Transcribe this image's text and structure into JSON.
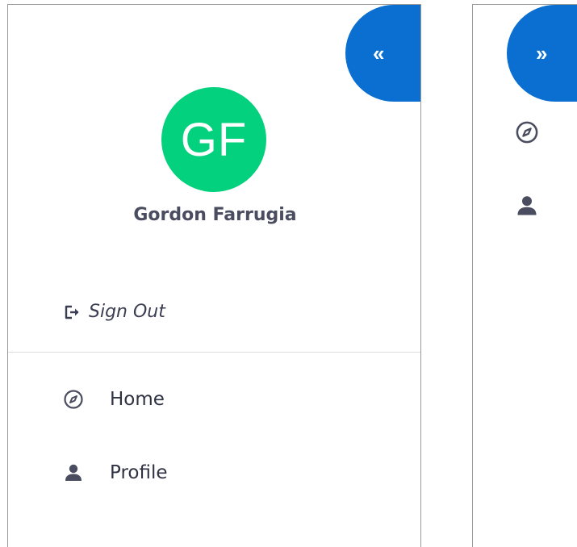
{
  "expanded_panel": {
    "collapse_button": {
      "label": "«",
      "icon": "double-chevron-left-icon"
    },
    "user": {
      "initials": "GF",
      "name": "Gordon Farrugia",
      "avatar_color": "#04d17d"
    },
    "sign_out": {
      "label": "Sign Out",
      "icon": "sign-out-icon"
    },
    "nav_items": [
      {
        "label": "Home",
        "icon": "compass-icon"
      },
      {
        "label": "Profile",
        "icon": "user-icon"
      }
    ]
  },
  "collapsed_panel": {
    "expand_button": {
      "label": "»",
      "icon": "double-chevron-right-icon"
    },
    "nav_items": [
      {
        "icon": "compass-icon"
      },
      {
        "icon": "user-icon"
      }
    ]
  },
  "colors": {
    "accent": "#0b6fd1",
    "text_dark": "#2f3242",
    "icon": "#4a4d5f",
    "divider": "#dcdcdc"
  }
}
